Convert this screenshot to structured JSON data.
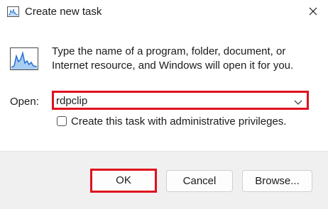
{
  "window": {
    "title": "Create new task"
  },
  "description": "Type the name of a program, folder, document, or Internet resource, and Windows will open it for you.",
  "open_field": {
    "label": "Open:",
    "value": "rdpclip"
  },
  "admin_checkbox": {
    "label": "Create this task with administrative privileges.",
    "checked": false
  },
  "buttons": {
    "ok": "OK",
    "cancel": "Cancel",
    "browse": "Browse..."
  },
  "colors": {
    "highlight": "#e0101e",
    "footer_bg": "#f0f0f0",
    "icon_blue": "#1f6fd1"
  },
  "icons": {
    "title": "task-manager-icon",
    "close": "close-icon",
    "run": "performance-graph-icon",
    "combo": "chevron-down-icon"
  }
}
